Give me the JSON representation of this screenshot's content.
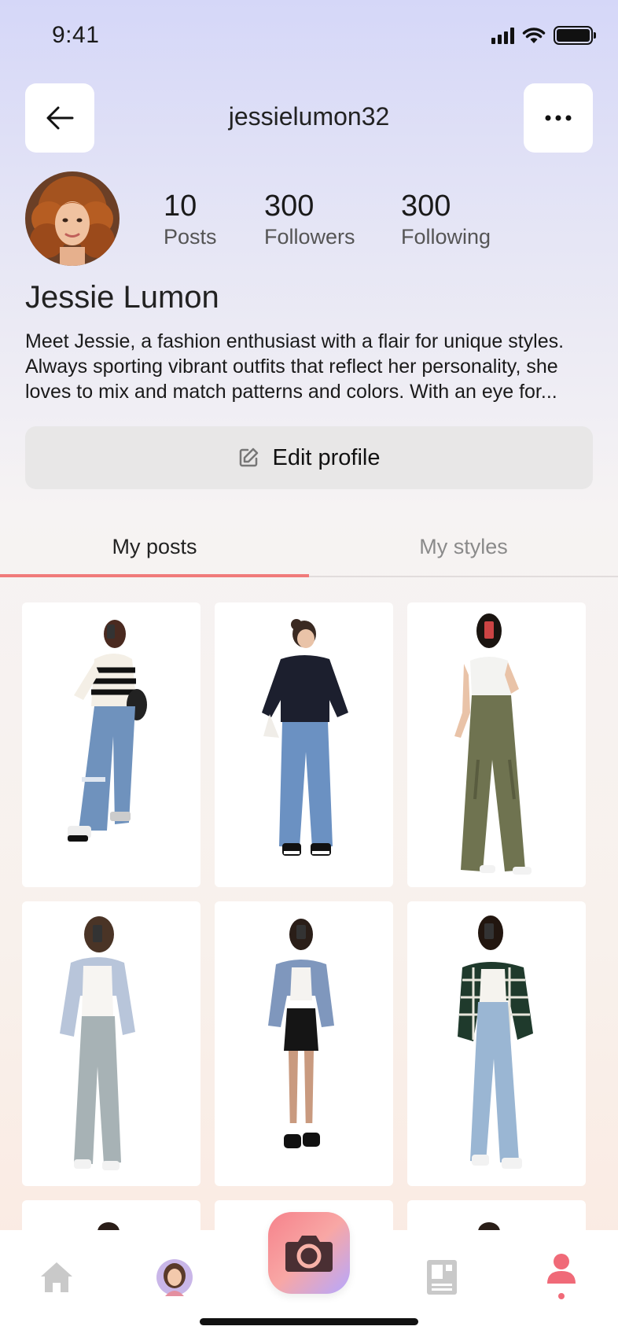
{
  "status_bar": {
    "time": "9:41"
  },
  "header": {
    "username": "jessielumon32"
  },
  "profile": {
    "stats": [
      {
        "number": "10",
        "label": "Posts"
      },
      {
        "number": "300",
        "label": "Followers"
      },
      {
        "number": "300",
        "label": "Following"
      }
    ],
    "display_name": "Jessie Lumon",
    "bio": "Meet Jessie, a fashion enthusiast with a flair for unique styles. Always sporting vibrant outfits that reflect her personality, she loves to mix and match patterns and colors. With an eye for..."
  },
  "edit_profile": {
    "label": "Edit profile",
    "icon": "edit-icon"
  },
  "tabs": [
    {
      "label": "My posts",
      "active": true
    },
    {
      "label": "My styles",
      "active": false
    }
  ],
  "posts": [
    {
      "top": "striped-sweater",
      "bottom": "ripped-jeans"
    },
    {
      "top": "black-sweatshirt",
      "bottom": "wide-jeans"
    },
    {
      "top": "white-tee",
      "bottom": "olive-cargo-pants"
    },
    {
      "top": "blue-shirt",
      "bottom": "grey-jeans"
    },
    {
      "top": "denim-shirt",
      "bottom": "black-shorts"
    },
    {
      "top": "plaid-shirt",
      "bottom": "light-jeans"
    }
  ],
  "bottom_nav": {
    "items": [
      "home-icon",
      "avatar",
      "camera-icon",
      "collection-icon",
      "profile-icon"
    ],
    "active": "profile-icon"
  },
  "colors": {
    "accent": "#f07a7a",
    "tab_inactive": "#8a8a8a",
    "edit_button_bg": "#e8e7e7"
  }
}
